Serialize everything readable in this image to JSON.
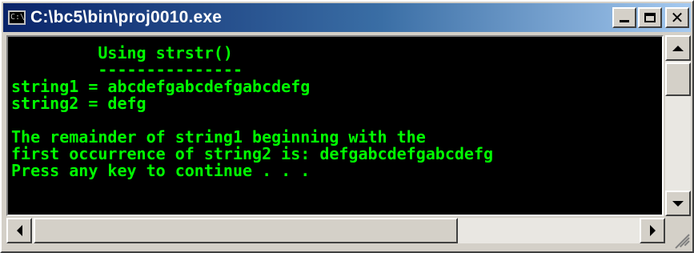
{
  "window": {
    "title": "C:\\bc5\\bin\\proj0010.exe",
    "icon": "console-icon",
    "icon_text": "C:\\"
  },
  "title_buttons": {
    "minimize_icon": "minimize-icon",
    "maximize_icon": "maximize-icon",
    "close_icon": "close-icon",
    "close_glyph": "✕"
  },
  "console": {
    "text_color": "#00ff00",
    "background_color": "#000000",
    "lines": [
      "         Using strstr()",
      "         ---------------",
      "string1 = abcdefgabcdefgabcdefg",
      "string2 = defg",
      "",
      "The remainder of string1 beginning with the",
      "first occurrence of string2 is: defgabcdefgabcdefg",
      "Press any key to continue . . ."
    ]
  }
}
